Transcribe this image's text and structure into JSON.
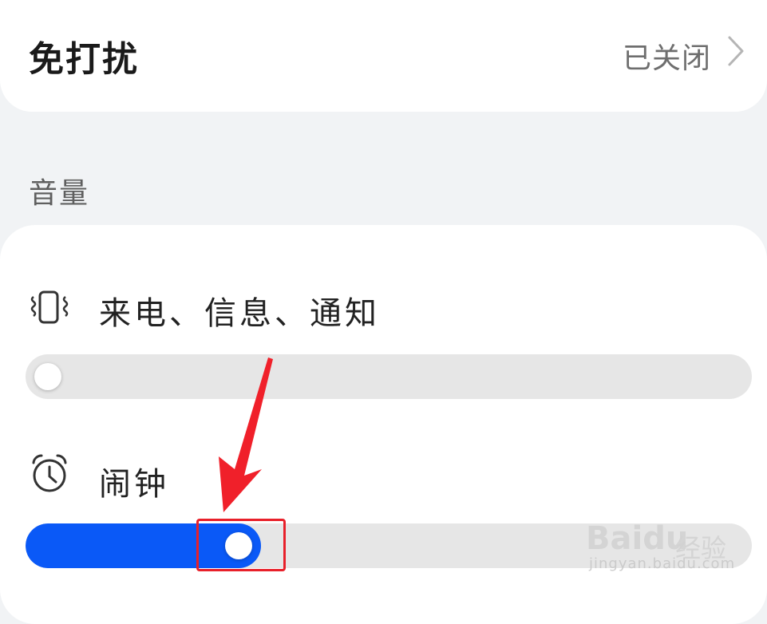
{
  "dnd": {
    "title": "免打扰",
    "status": "已关闭"
  },
  "volume_section": {
    "title": "音量",
    "rows": [
      {
        "label": "来电、信息、通知",
        "icon": "vibrate-icon",
        "level": 0.0
      },
      {
        "label": "闹钟",
        "icon": "alarm-clock-icon",
        "level": 0.28
      }
    ]
  },
  "annotation": {
    "arrow_color": "#e8202a",
    "box_color": "#e8202a"
  },
  "watermark": {
    "logo": "Baidu",
    "cn": "经验",
    "url": "jingyan.baidu.com"
  },
  "colors": {
    "accent": "#0a59f7",
    "track": "#e6e6e6",
    "background": "#f1f3f5",
    "card": "#ffffff"
  }
}
